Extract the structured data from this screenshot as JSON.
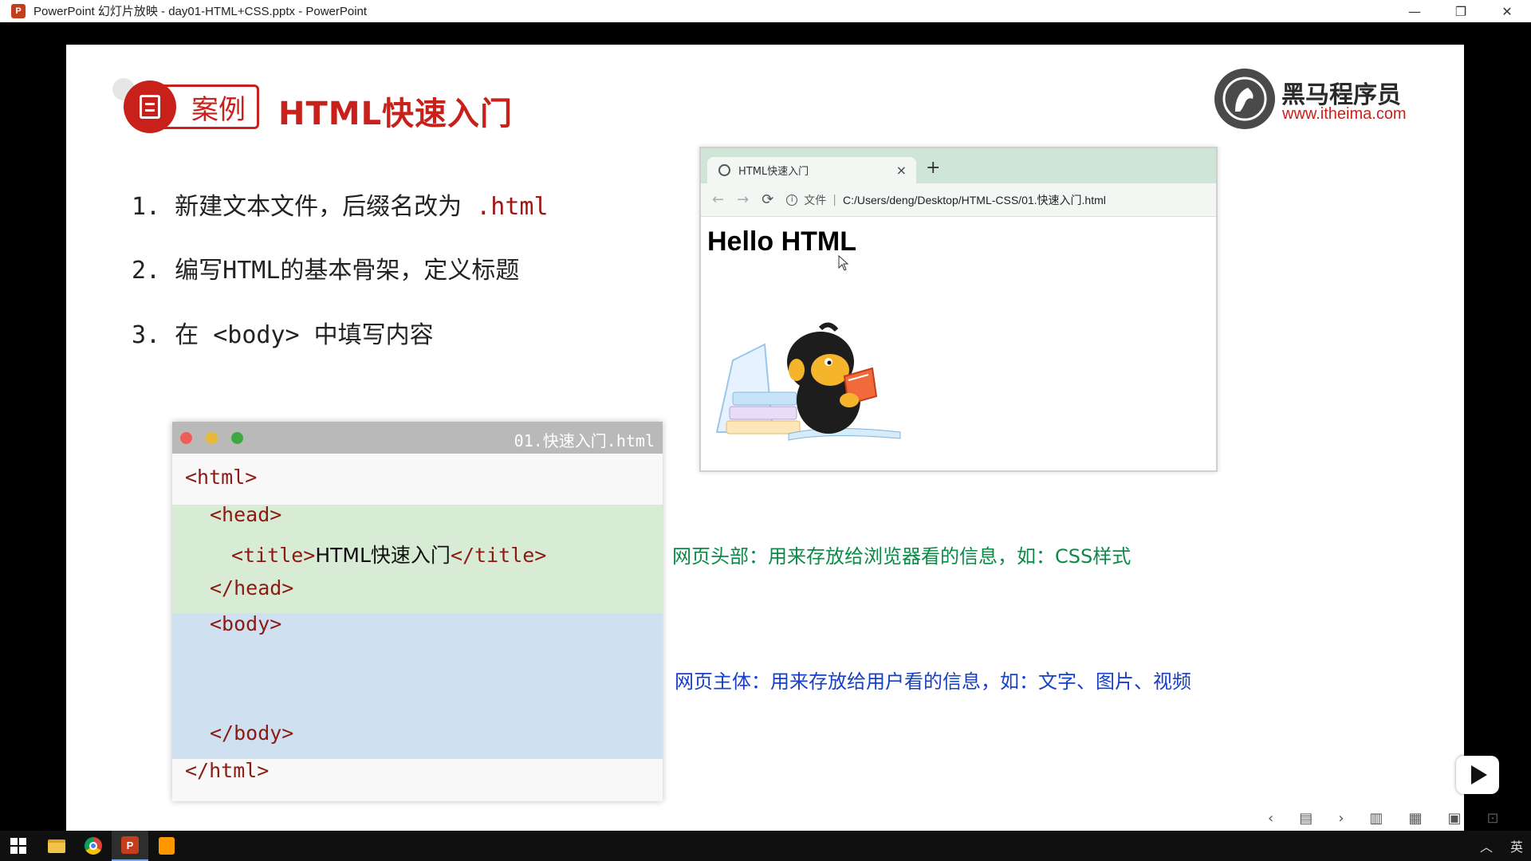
{
  "window": {
    "title": "PowerPoint 幻灯片放映  -  day01-HTML+CSS.pptx - PowerPoint",
    "app_icon_letter": "P",
    "minimize": "—",
    "restore": "❐",
    "close": "✕"
  },
  "slide": {
    "badge_label": "案例",
    "title": "HTML快速入门",
    "logo": {
      "name": "黑马程序员",
      "url": "www.itheima.com"
    },
    "steps": [
      {
        "text": "1. 新建文本文件，后缀名改为 ",
        "highlight": ".html"
      },
      {
        "text": "2. 编写HTML的基本骨架，定义标题"
      },
      {
        "text": "3. 在 <body> 中填写内容"
      }
    ],
    "browser": {
      "tab_title": "HTML快速入门",
      "tab_close": "×",
      "new_tab": "+",
      "back": "←",
      "forward": "→",
      "reload": "⟳",
      "info": "i",
      "file_label": "文件",
      "separator": "|",
      "url": "C:/Users/deng/Desktop/HTML-CSS/01.快速入门.html",
      "heading": "Hello HTML"
    },
    "editor": {
      "filename": "01.快速入门.html",
      "dot_colors": [
        "#ec5f57",
        "#e7b93a",
        "#3ea844"
      ],
      "lines": [
        {
          "tag_open": "<html>"
        },
        {
          "tag_open": "<head>"
        },
        {
          "tag_open": "<title>",
          "text": "HTML快速入门",
          "tag_close": "</title>"
        },
        {
          "tag_open": "</head>"
        },
        {
          "tag_open": "<body>"
        },
        {
          "tag_open": "</body>"
        },
        {
          "tag_open": "</html>"
        }
      ]
    },
    "notes": {
      "head": "网页头部：用来存放给浏览器看的信息，如：CSS样式",
      "body": "网页主体：用来存放给用户看的信息，如：文字、图片、视频"
    }
  },
  "slideshow_controls": [
    "‹",
    "▤",
    "›",
    "▥",
    "▦",
    "▣",
    "⊡"
  ],
  "taskbar": {
    "tray_ime": "英",
    "tray_arrow": "︿"
  },
  "colors": {
    "accent_red": "#c8211c",
    "head_band": "#d7ebd5",
    "body_band": "#cfe0f1",
    "note_green": "#0b8a46",
    "note_blue": "#1740c8"
  }
}
